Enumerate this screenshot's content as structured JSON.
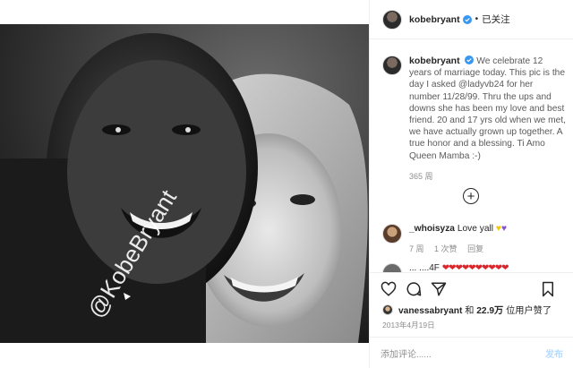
{
  "photo": {
    "watermark": "@KobeBryant"
  },
  "header": {
    "username": "kobebryant",
    "separator": "•",
    "follow_status": "已关注"
  },
  "caption": {
    "username": "kobebryant",
    "text": "We celebrate 12 years of marriage today. This pic is the day I asked @ladyvb24 for her number 11/28/99. Thru the ups and downs she has been my love and best friend. 20 and 17 yrs old when we met, we have actually grown up together. A true honor and a blessing. Ti Amo Queen Mamba :-)",
    "time": "365 周"
  },
  "comments": [
    {
      "username": "_whoisyza",
      "text": "Love yall",
      "time": "7 周",
      "likes": "1 次赞",
      "reply": "回复"
    }
  ],
  "comment2_partial": {
    "prefix": "...  ....4F",
    "reds": "❤❤❤❤❤❤❤❤❤❤"
  },
  "likes": {
    "user": "vanessabryant",
    "joiner": "和",
    "count": "22.9万",
    "suffix": "位用户赞了"
  },
  "post_date": "2013年4月19日",
  "add_comment": {
    "placeholder": "添加评论......",
    "post_label": "发布"
  },
  "colors": {
    "verified_blue": "#3897f0",
    "muted_text": "#8e8e8e",
    "post_button": "#b3dbff"
  }
}
